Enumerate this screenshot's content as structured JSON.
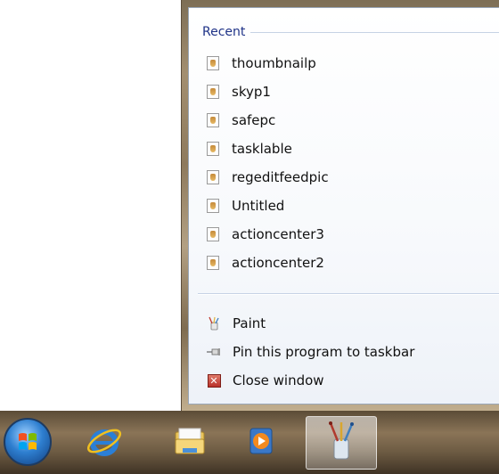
{
  "jumplist": {
    "category_title": "Recent",
    "recent_items": [
      {
        "label": "thoumbnailp"
      },
      {
        "label": "skyp1"
      },
      {
        "label": "safepc"
      },
      {
        "label": "tasklable"
      },
      {
        "label": "regeditfeedpic"
      },
      {
        "label": "Untitled"
      },
      {
        "label": "actioncenter3"
      },
      {
        "label": "actioncenter2"
      }
    ],
    "tasks": {
      "program_label": "Paint",
      "pin_label": "Pin this program to taskbar",
      "close_label": "Close window"
    }
  },
  "taskbar": {
    "buttons": [
      {
        "icon": "start-orb-icon"
      },
      {
        "icon": "internet-explorer-icon"
      },
      {
        "icon": "windows-explorer-icon"
      },
      {
        "icon": "media-player-icon"
      },
      {
        "icon": "paint-icon",
        "active": true
      }
    ]
  },
  "colors": {
    "category_title": "#1e3287",
    "menu_background": "#ffffff",
    "taskbar": "#6d5b43"
  }
}
